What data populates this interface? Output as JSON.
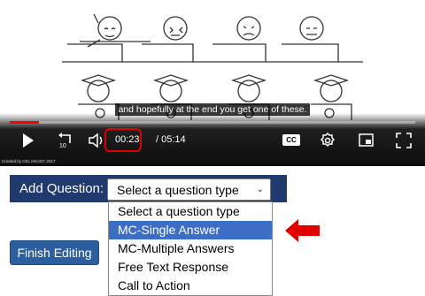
{
  "video": {
    "subtitle": "and hopefully at the end you get one of these.",
    "progress_fraction": 0.073,
    "current_time": "00:23",
    "total_time": "/ 05:14",
    "cc_label": "CC",
    "credit": "Created by CEL HKUST, 2017",
    "colors": {
      "progress": "#ff0000",
      "highlight": "#e00000"
    }
  },
  "add_question": {
    "label": "Add Question:",
    "selected": "Select a question type",
    "options": [
      "Select a question type",
      "MC-Single Answer",
      "MC-Multiple Answers",
      "Free Text Response",
      "Call to Action"
    ],
    "highlighted_option": 1
  },
  "finish_button": {
    "label": "Finish Editing"
  },
  "colors": {
    "bar": "#203a6e",
    "selected_option": "#3b6ec4",
    "button": "#2c5fa0",
    "arrow": "#e00000"
  }
}
